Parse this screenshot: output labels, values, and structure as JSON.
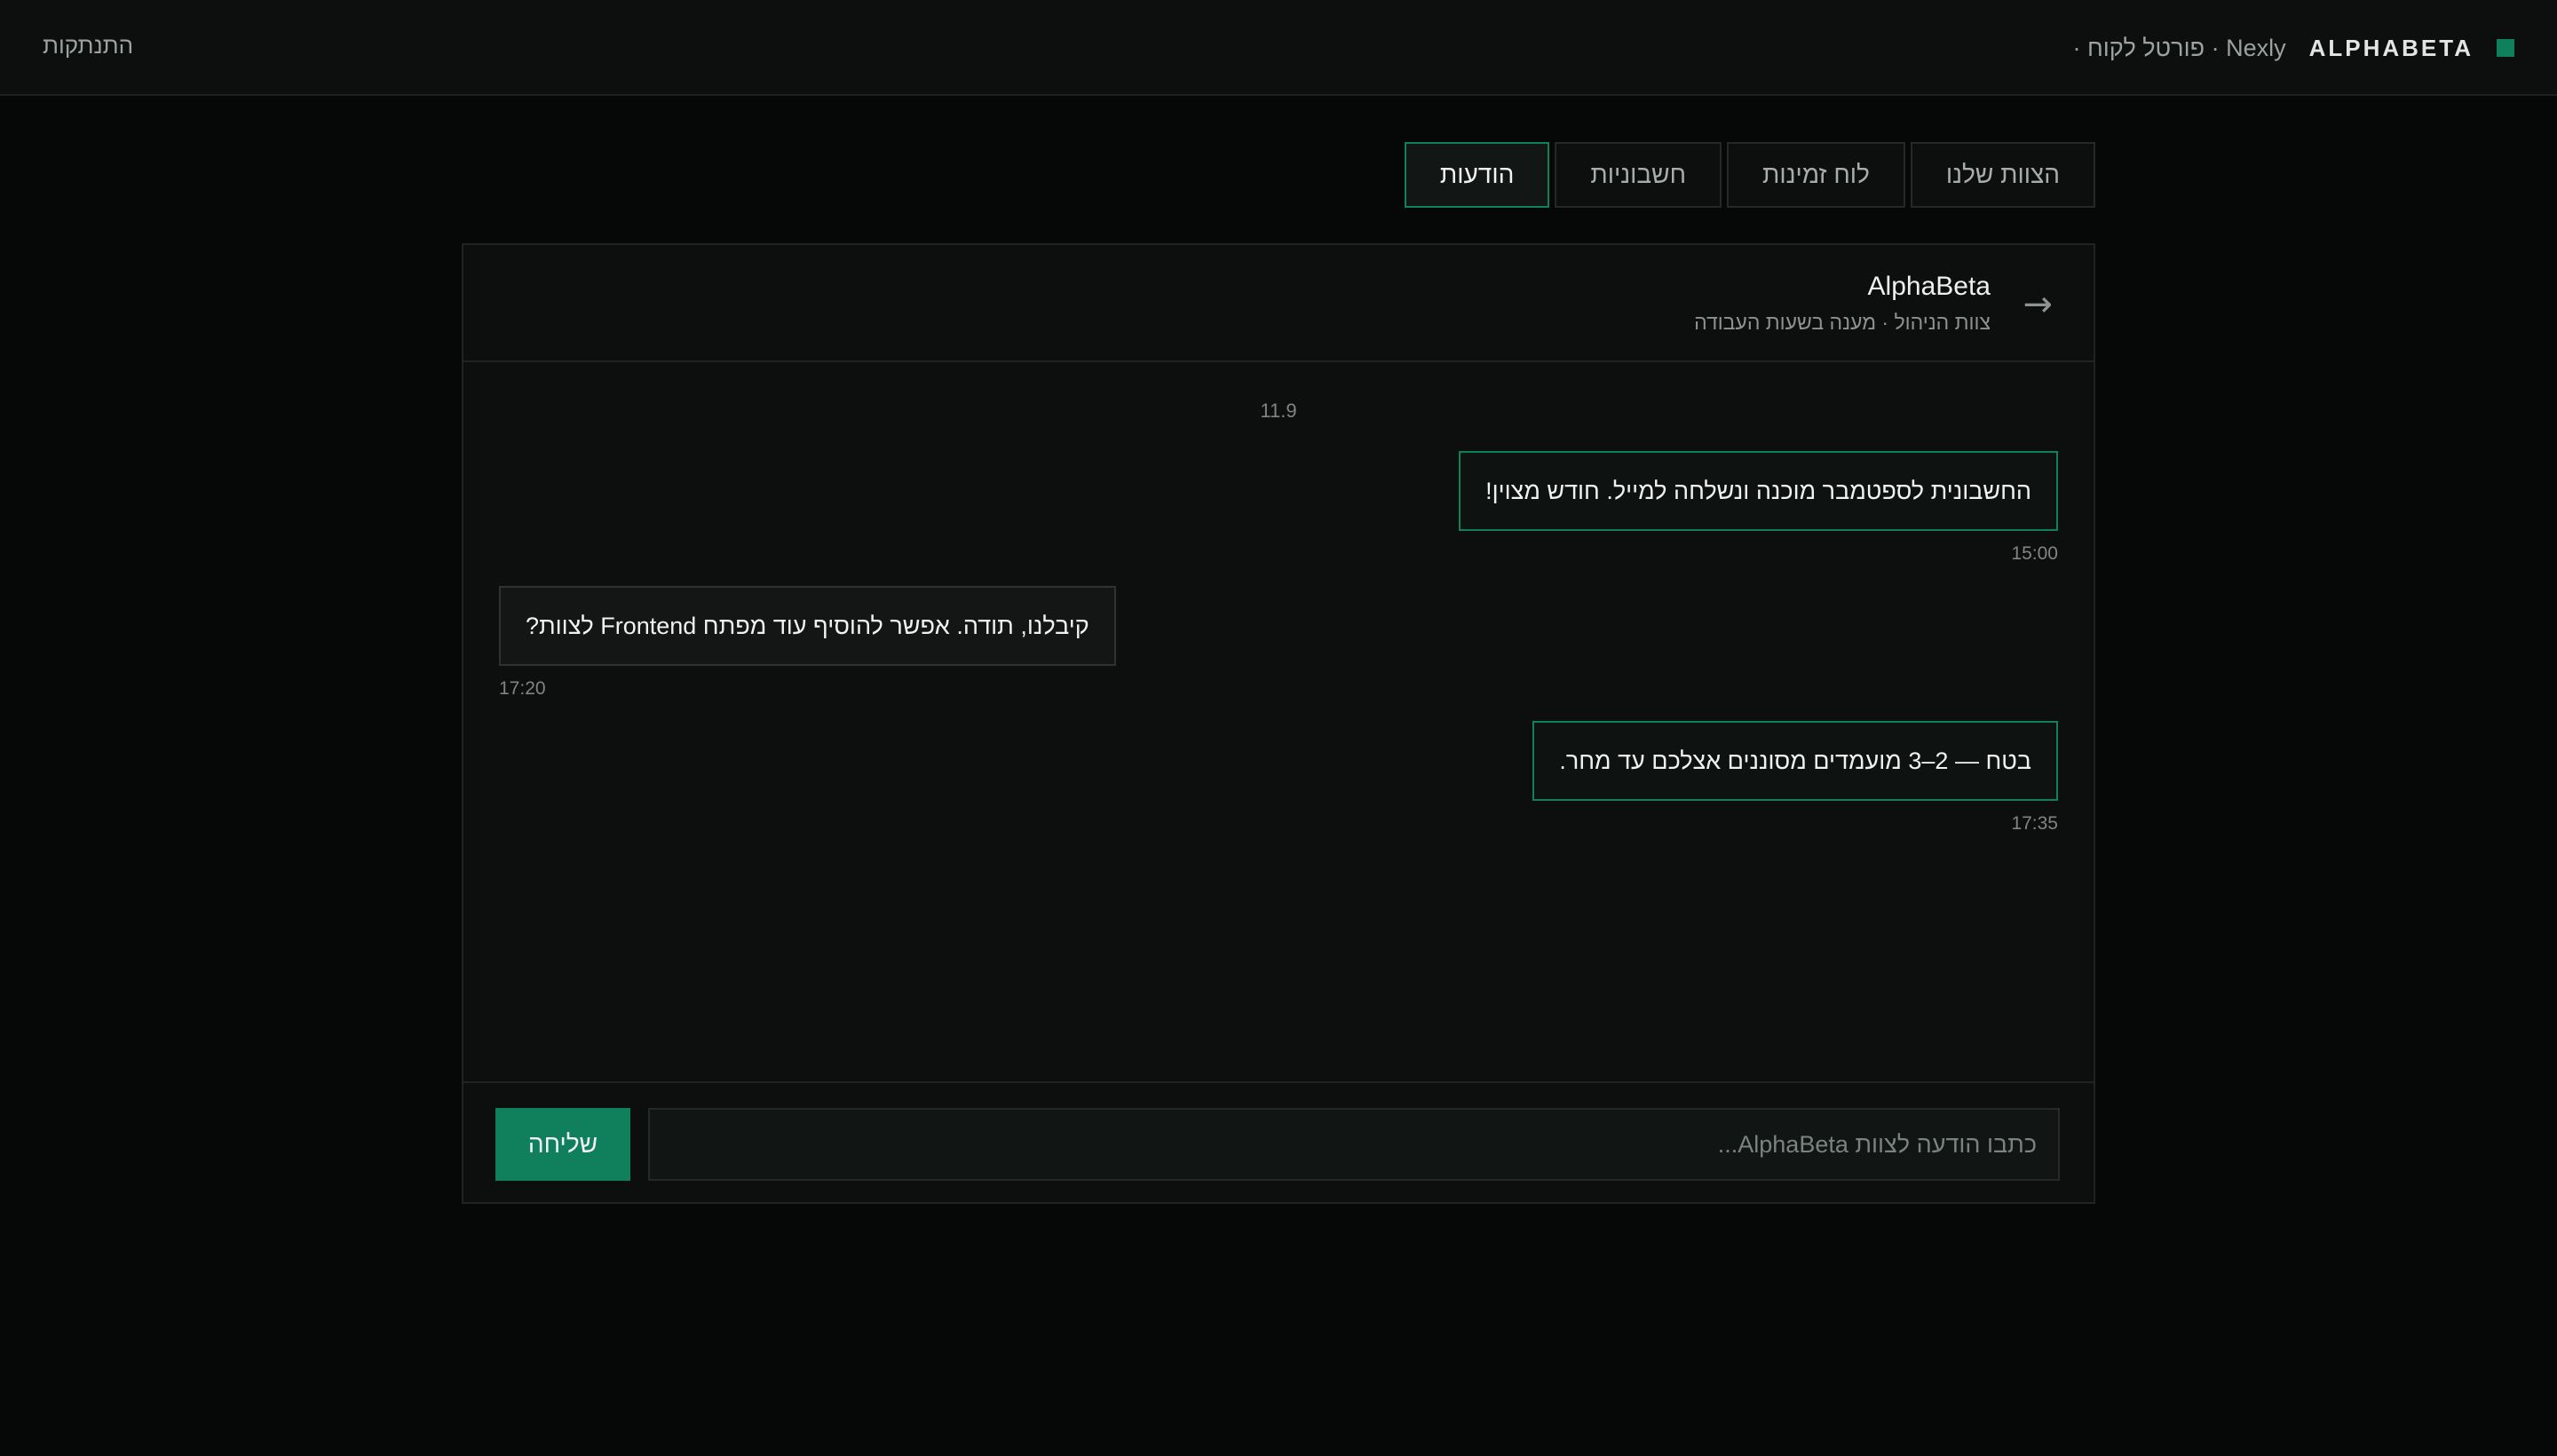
{
  "header": {
    "brand_name": "ALPHABETA",
    "brand_sub": "Nexly · פורטל לקוח ·",
    "logout_label": "התנתקות"
  },
  "tabs": [
    {
      "label": "הצוות שלנו",
      "active": false
    },
    {
      "label": "לוח זמינות",
      "active": false
    },
    {
      "label": "חשבוניות",
      "active": false
    },
    {
      "label": "הודעות",
      "active": true
    }
  ],
  "chat": {
    "contact_name": "AlphaBeta",
    "contact_sub": "צוות הניהול · מענה בשעות העבודה",
    "date_separator": "11.9",
    "messages": [
      {
        "direction": "out",
        "text": "החשבונית לספטמבר מוכנה ונשלחה למייל. חודש מצוין!",
        "time": "15:00"
      },
      {
        "direction": "in",
        "text": "קיבלנו, תודה. אפשר להוסיף עוד מפתח Frontend לצוות?",
        "time": "17:20"
      },
      {
        "direction": "out",
        "text": "בטח — 2–3 מועמדים מסוננים אצלכם עד מחר.",
        "time": "17:35"
      }
    ]
  },
  "composer": {
    "placeholder": "כתבו הודעה לצוות AlphaBeta...",
    "value": "",
    "send_label": "שליחה"
  },
  "icons": {
    "back": "arrow-right-icon",
    "brand": "square-logo-icon"
  },
  "colors": {
    "accent": "#0f7f5c",
    "background": "#060807",
    "panel": "#0d0f0e"
  }
}
